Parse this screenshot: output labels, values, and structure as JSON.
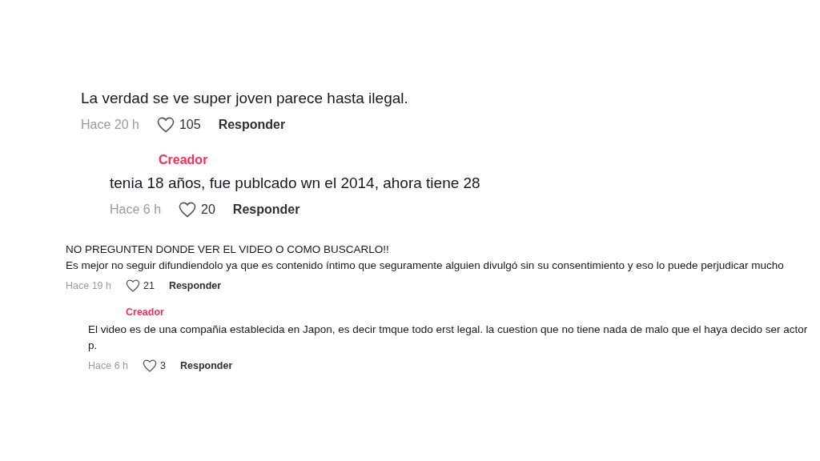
{
  "sections": [
    {
      "kind": "large",
      "comment": {
        "lines": [
          "La verdad se ve super joven parece hasta ilegal."
        ],
        "time": "Hace 20 h",
        "likes": "105",
        "reply": "Responder"
      },
      "replies": [
        {
          "badge": "Creador",
          "lines": [
            "tenia 18 años, fue publcado wn el 2014, ahora tiene 28"
          ],
          "time": "Hace 6 h",
          "likes": "20",
          "reply": "Responder"
        }
      ]
    },
    {
      "kind": "small",
      "comment": {
        "lines": [
          "NO PREGUNTEN DONDE VER EL VIDEO O COMO BUSCARLO!!",
          "Es mejor no seguir difundiendolo ya que es contenido íntimo que seguramente alguien divulgó sin su consentimiento y eso lo puede perjudicar mucho"
        ],
        "time": "Hace 19 h",
        "likes": "21",
        "reply": "Responder"
      },
      "replies": [
        {
          "badge": "Creador",
          "lines": [
            "El video es de una compañia establecida en Japon, es decir tmque todo erst legal. la cuestion que no tiene nada de malo que el haya decido ser actor p."
          ],
          "time": "Hace 6 h",
          "likes": "3",
          "reply": "Responder"
        }
      ]
    }
  ]
}
